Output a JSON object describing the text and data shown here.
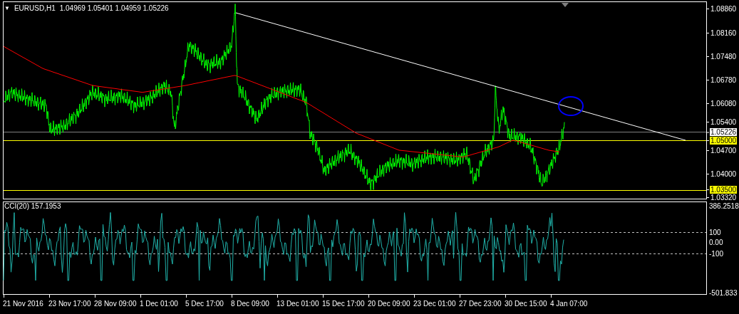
{
  "chart": {
    "menu_icon": "▼",
    "symbol": "EURUSD,H1",
    "ohlc": "1.04969 1.05401 1.04959 1.05226",
    "price_axis": [
      {
        "label": "1.08860",
        "kind": "tick"
      },
      {
        "label": "1.08160",
        "kind": "tick"
      },
      {
        "label": "1.07480",
        "kind": "tick"
      },
      {
        "label": "1.06780",
        "kind": "tick"
      },
      {
        "label": "1.06080",
        "kind": "tick"
      },
      {
        "label": "1.05400",
        "kind": "tick"
      },
      {
        "label": "1.05226",
        "kind": "current"
      },
      {
        "label": "1.05000",
        "kind": "level"
      },
      {
        "label": "1.04700",
        "kind": "tick"
      },
      {
        "label": "1.04000",
        "kind": "tick"
      },
      {
        "label": "1.03500",
        "kind": "level"
      },
      {
        "label": "1.03320",
        "kind": "tick"
      }
    ]
  },
  "indicator": {
    "title": "CCI(20) 157.1953",
    "axis": [
      "386.2518",
      "100",
      "0.00",
      "-100",
      "-501.833"
    ]
  },
  "time_axis": [
    "21 Nov 2016",
    "23 Nov 17:00",
    "28 Nov 09:00",
    "1 Dec 01:00",
    "5 Dec 17:00",
    "8 Dec 09:00",
    "13 Dec 01:00",
    "15 Dec 17:00",
    "20 Dec 09:00",
    "23 Dec 01:00",
    "27 Dec 23:00",
    "30 Dec 15:00",
    "4 Jan 07:00"
  ]
}
